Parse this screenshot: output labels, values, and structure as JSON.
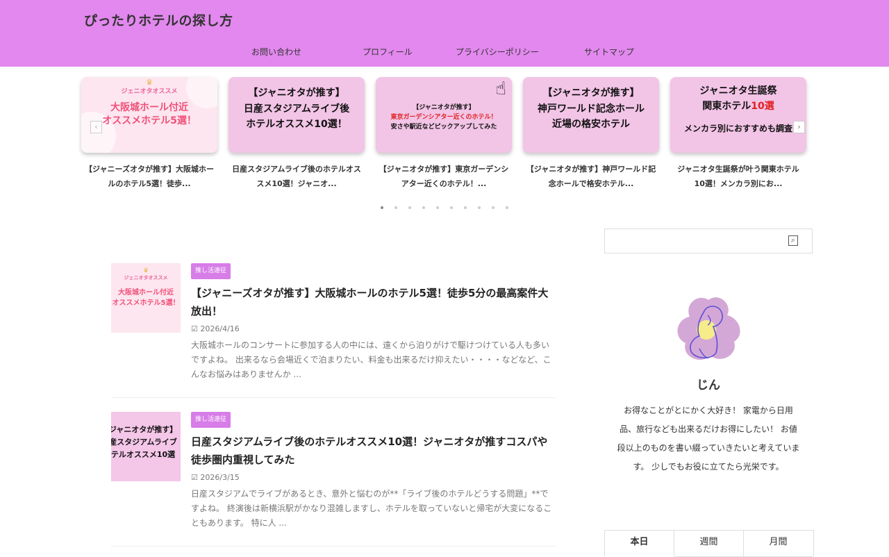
{
  "site": {
    "title": "ぴったりホテルの探し方"
  },
  "nav": [
    "お問い合わせ",
    "プロフィール",
    "プライバシーポリシー",
    "サイトマップ"
  ],
  "carousel": {
    "cards": [
      {
        "caption": "【ジャニーズオタが推す】大阪城ホールのホテル5選！徒歩...",
        "image_text": [
          "ジェニオタオススメ",
          "大阪城ホール付近",
          "オススメホテル5選！"
        ]
      },
      {
        "caption": "日産スタジアムライブ後のホテルオススメ10選！ジャニオ...",
        "image_text": [
          "【ジャニオタが推す】",
          "日産スタジアムライブ後",
          "ホテルオススメ10選！"
        ]
      },
      {
        "caption": "【ジャニオタが推す】東京ガーデンシアター近くのホテル！...",
        "image_text": [
          "【ジャニオタが推す】",
          "東京ガーデンシアター近くのホテル！",
          "安さや駅近などピックアップしてみた"
        ]
      },
      {
        "caption": "【ジャニオタが推す】神戸ワールド記念ホールで格安ホテル...",
        "image_text": [
          "【ジャニオタが推す】",
          "神戸ワールド記念ホール",
          "近場の格安ホテル"
        ]
      },
      {
        "caption": "ジャニオタ生誕祭が叶う関東ホテル10選！メンカラ別にお...",
        "image_text": [
          "ジャニオタ生誕祭",
          "関東ホテル",
          "10選",
          "メンカラ別におすすめも調査"
        ]
      }
    ],
    "dot_count": 10,
    "active_dot": 1
  },
  "posts": [
    {
      "category": "推し活遠征",
      "title": "【ジャニーズオタが推す】大阪城ホールのホテル5選！徒歩5分の最高案件大放出！",
      "date": "2026/4/16",
      "excerpt": "大阪城ホールのコンサートに参加する人の中には、遠くから泊りがけで駆けつけている人も多いですよね。 出来るなら会場近くで泊まりたい、料金も出来るだけ抑えたい・・・・などなど、こんなお悩みはありませんか ...",
      "thumb_text": [
        "ジェニオタオススメ",
        "大阪城ホール付近",
        "オススメホテル5選！"
      ]
    },
    {
      "category": "推し活遠征",
      "title": "日産スタジアムライブ後のホテルオススメ10選！ジャニオタが推すコスパや徒歩圏内重視してみた",
      "date": "2026/3/15",
      "excerpt": "日産スタジアムでライブがあるとき、意外と悩むのが**「ライブ後のホテルどうする問題」**ですよね。 終演後は新横浜駅がかなり混雑しますし、ホテルを取っていないと帰宅が大変になることもあります。 特に人 ...",
      "thumb_text": [
        "ジャニオタが推す】",
        "産スタジアムライブ",
        "テルオススメ10選"
      ]
    }
  ],
  "sidebar": {
    "profile_name": "じん",
    "profile_desc": "お得なことがとにかく大好き！ 家電から日用品、旅行なども出来るだけお得にしたい！ お値段以上のものを書い綴っていきたいと考えています。 少しでもお役に立てたら光栄です。",
    "tabs": [
      "本日",
      "週間",
      "月間"
    ]
  },
  "colors": {
    "header_bg": "#e288ee",
    "badge_bg": "#d77de8"
  },
  "icons": {
    "search": "search-icon",
    "date": "calendar-icon",
    "slider_prev": "chevron-left-icon",
    "slider_next": "chevron-right-icon"
  }
}
